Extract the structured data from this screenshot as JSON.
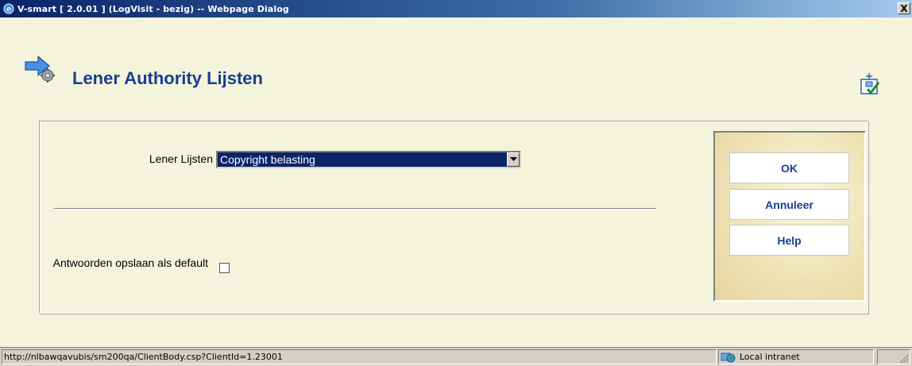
{
  "window": {
    "title": "V-smart [ 2.0.01 ] (LogVisit - bezig) -- Webpage Dialog",
    "close_label": "X"
  },
  "page": {
    "title": "Lener Authority Lijsten"
  },
  "form": {
    "lijsten_label": "Lener Lijsten",
    "lijsten_value": "Copyright belasting",
    "default_label": "Antwoorden opslaan als default",
    "default_checked": false
  },
  "buttons": {
    "ok": "OK",
    "cancel": "Annuleer",
    "help": "Help"
  },
  "status": {
    "url": "http://nlbawqavubis/sm200qa/ClientBody.csp?ClientId=1.23001",
    "zone": "Local intranet"
  },
  "icons": {
    "title_icon": "ie-icon",
    "header_icon": "arrow-gear-icon",
    "workflow_icon": "workflow-check-icon",
    "zone_icon": "globe-icon",
    "dropdown_icon": "chevron-down-icon"
  },
  "colors": {
    "accent": "#1a3d8f",
    "background": "#f4f4dc",
    "selection": "#0a246a"
  }
}
